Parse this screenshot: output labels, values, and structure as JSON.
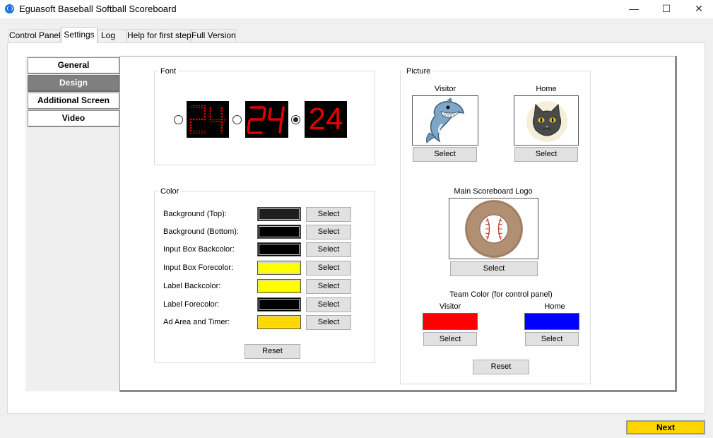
{
  "window": {
    "title": "Eguasoft Baseball Softball Scoreboard",
    "minimize_glyph": "—",
    "maximize_glyph": "☐",
    "close_glyph": "✕"
  },
  "tabs": [
    {
      "label": "Control Panel"
    },
    {
      "label": "Settings"
    },
    {
      "label": "Log"
    },
    {
      "label": "Help for first step"
    },
    {
      "label": "Full Version"
    }
  ],
  "active_tab": "Settings",
  "side_nav": [
    {
      "label": "General"
    },
    {
      "label": "Design"
    },
    {
      "label": "Additional Screen"
    },
    {
      "label": "Video"
    }
  ],
  "active_side_nav": "Design",
  "font_group": {
    "title": "Font",
    "sample": "24",
    "selected_option": 3
  },
  "color_group": {
    "title": "Color",
    "rows": [
      {
        "label": "Background (Top):",
        "color": "#1e1e1e",
        "button": "Select"
      },
      {
        "label": "Background (Bottom):",
        "color": "#000000",
        "button": "Select"
      },
      {
        "label": "Input Box Backcolor:",
        "color": "#000000",
        "button": "Select"
      },
      {
        "label": "Input Box Forecolor:",
        "color": "#ffff00",
        "button": "Select"
      },
      {
        "label": "Label Backcolor:",
        "color": "#ffff00",
        "button": "Select"
      },
      {
        "label": "Label Forecolor:",
        "color": "#000000",
        "button": "Select"
      },
      {
        "label": "Ad Area and Timer:",
        "color": "#ffd700",
        "button": "Select"
      }
    ],
    "reset_label": "Reset"
  },
  "picture_group": {
    "title": "Picture",
    "visitor_label": "Visitor",
    "home_label": "Home",
    "visitor_select": "Select",
    "home_select": "Select",
    "visitor_icon": "shark-logo-icon",
    "home_icon": "cat-logo-icon",
    "main_logo_label": "Main Scoreboard Logo",
    "main_logo_icon": "baseball-logo-icon",
    "main_logo_select": "Select",
    "team_color_title": "Team Color (for control panel)",
    "team_visitor_label": "Visitor",
    "team_home_label": "Home",
    "team_visitor_color": "#ff0000",
    "team_home_color": "#0000ff",
    "team_visitor_select": "Select",
    "team_home_select": "Select",
    "reset_label": "Reset"
  },
  "next_button": "Next",
  "colors": {
    "accent_yellow": "#ffd500",
    "digit_red": "#e60000",
    "side_active_bg": "#7f7f7f"
  }
}
